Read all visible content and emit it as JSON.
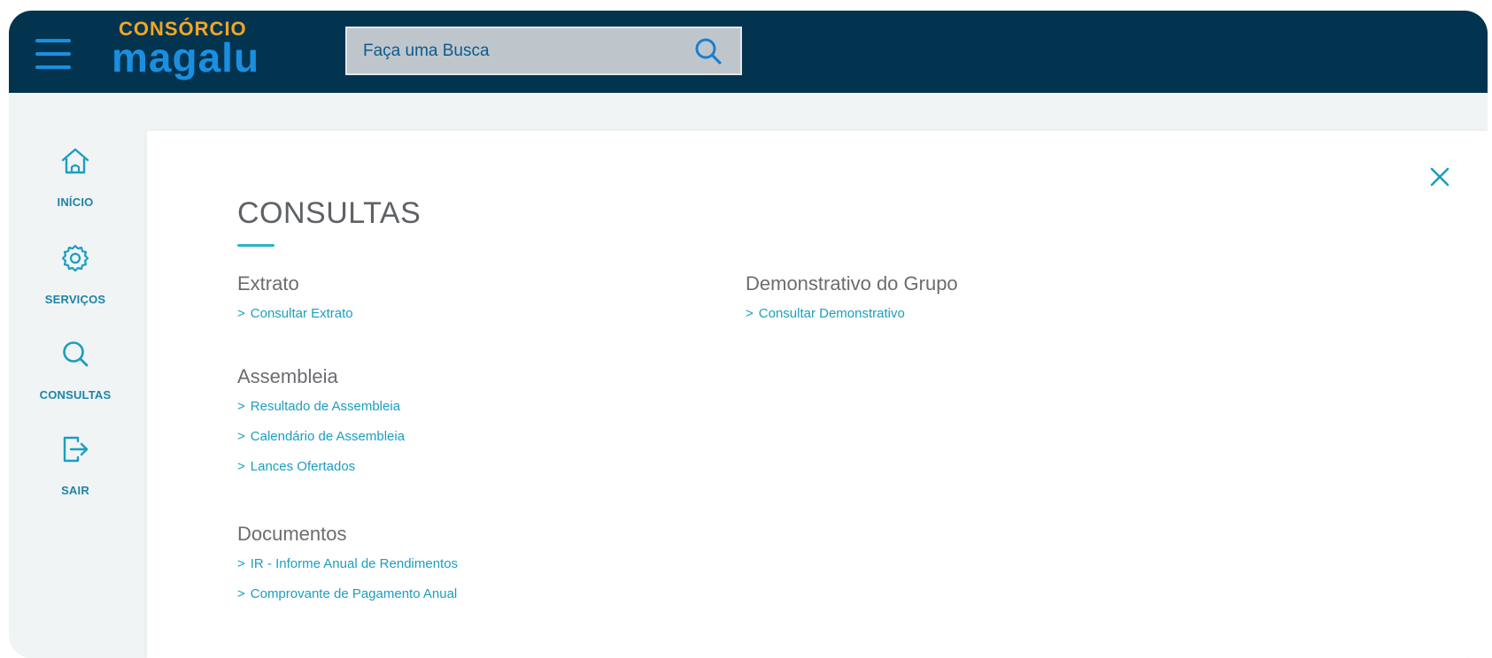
{
  "header": {
    "logo_top": "CONSÓRCIO",
    "logo_main": "magalu",
    "search_placeholder": "Faça uma Busca",
    "brand_colors": {
      "bar": "#03344f",
      "accent_blue": "#1a8fe0",
      "accent_orange": "#f5a623"
    }
  },
  "sidebar": {
    "items": [
      {
        "label": "INÍCIO",
        "icon": "home-icon"
      },
      {
        "label": "SERVIÇOS",
        "icon": "gear-icon"
      },
      {
        "label": "CONSULTAS",
        "icon": "search-icon"
      },
      {
        "label": "SAIR",
        "icon": "logout-icon"
      }
    ]
  },
  "panel": {
    "title": "CONSULTAS",
    "close_icon": "close-icon",
    "link_color": "#1b9ec0",
    "sections": [
      {
        "heading": "Extrato",
        "links": [
          "Consultar Extrato"
        ]
      },
      {
        "heading": "Assembleia",
        "links": [
          "Resultado de Assembleia",
          "Calendário de Assembleia",
          "Lances Ofertados"
        ]
      },
      {
        "heading": "Documentos",
        "links": [
          "IR - Informe Anual de Rendimentos",
          "Comprovante de Pagamento Anual"
        ]
      },
      {
        "heading": "Demonstrativo do Grupo",
        "links": [
          "Consultar Demonstrativo"
        ]
      }
    ]
  }
}
